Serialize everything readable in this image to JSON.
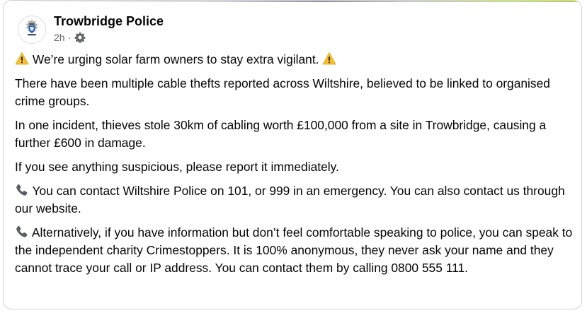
{
  "post": {
    "page_name": "Trowbridge Police",
    "timestamp": "2h",
    "separator": "·",
    "audience_icon": "gear-icon",
    "avatar_icon": "police-crest-icon",
    "paragraphs": {
      "p1": "We’re urging solar farm owners to stay extra vigilant.",
      "p2": "There have been multiple cable thefts reported across Wiltshire, believed to be linked to organised crime groups.",
      "p3": "In one incident, thieves stole 30km of cabling worth £100,000 from a site in Trowbridge, causing a further £600 in damage.",
      "p4": "If you see anything suspicious, please report it immediately.",
      "p5": "You can contact Wiltshire Police on 101, or 999 in an emergency. You can also contact us through our website.",
      "p6": "Alternatively, if you have information but don’t feel comfortable speaking to police, you can speak to the independent charity Crimestoppers. It is 100% anonymous, they never ask your name and they cannot trace your call or IP address. You can contact them by calling 0800 555 111."
    },
    "emoji_icons": {
      "warning": "warning-icon",
      "phone": "telephone-icon"
    }
  },
  "colors": {
    "text": "#050505",
    "secondary_text": "#65676b",
    "border": "#cfd3d8",
    "warning_yellow": "#f7c02a",
    "accent_strip": "#b4d23a"
  }
}
